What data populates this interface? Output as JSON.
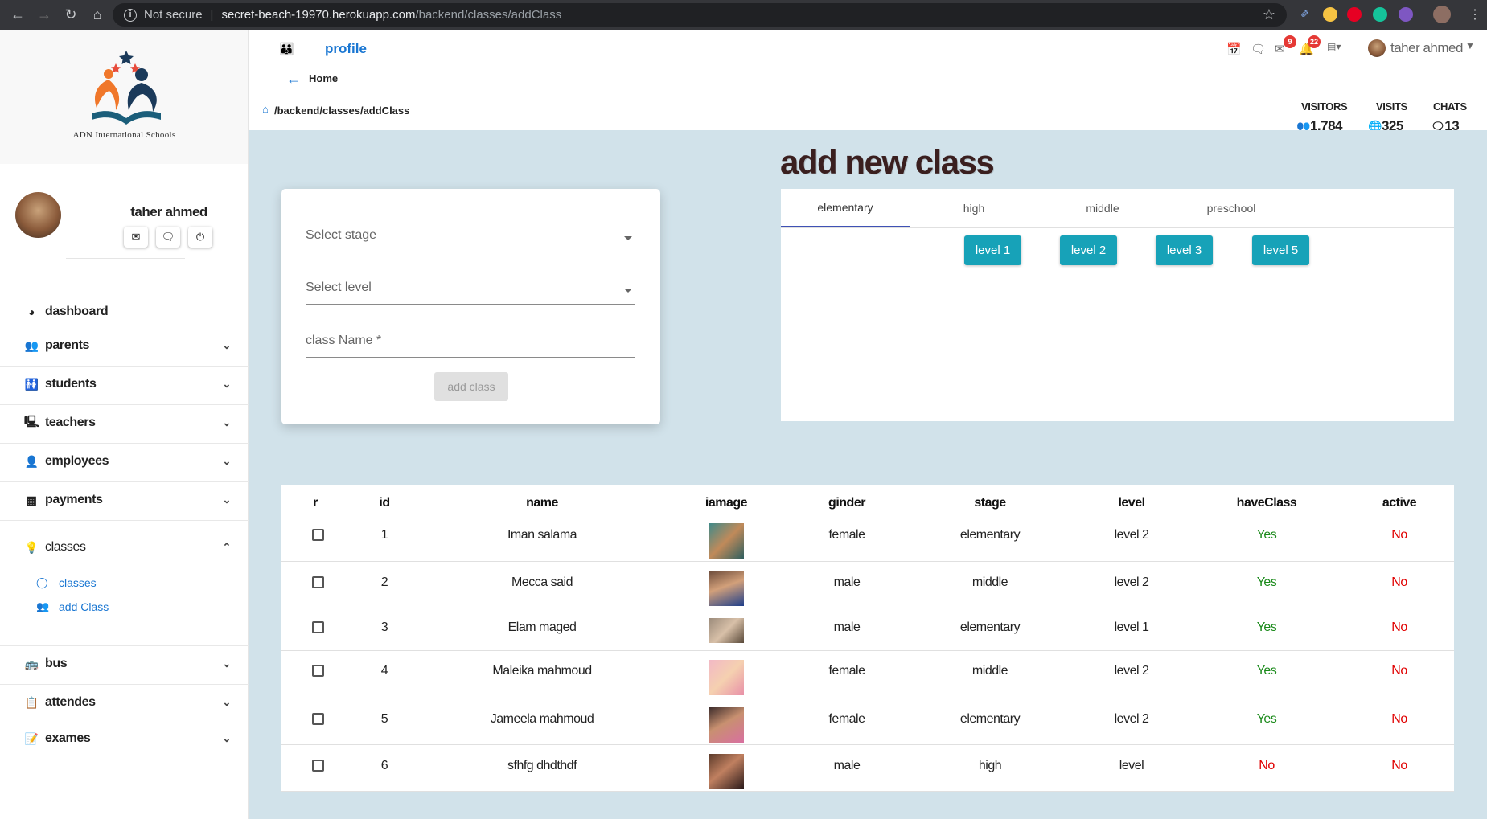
{
  "browser": {
    "security": "Not secure",
    "url_host": "secret-beach-19970.herokuapp.com",
    "url_path": "/backend/classes/addClass",
    "badges": [
      "9",
      "22"
    ]
  },
  "sidebar": {
    "logo_text": "ADN International Schools",
    "user_name": "taher ahmed",
    "items": [
      {
        "label": "dashboard",
        "icon": "dashboard-icon"
      },
      {
        "label": "parents",
        "icon": "parents-icon"
      },
      {
        "label": "students",
        "icon": "students-icon"
      },
      {
        "label": "teachers",
        "icon": "teachers-icon"
      },
      {
        "label": "employees",
        "icon": "employees-icon"
      },
      {
        "label": "payments",
        "icon": "payments-icon"
      },
      {
        "label": "classes",
        "icon": "lightbulb-icon"
      },
      {
        "label": "bus",
        "icon": "bus-icon"
      },
      {
        "label": "attendes",
        "icon": "clipboard-icon"
      },
      {
        "label": "exames",
        "icon": "exam-icon"
      }
    ],
    "sub_items": [
      {
        "label": "classes"
      },
      {
        "label": "add Class"
      }
    ]
  },
  "header": {
    "profile_label": "profile",
    "home_label": "Home",
    "breadcrumb": "/backend/classes/addClass",
    "user_name": "taher ahmed",
    "stats": {
      "visitors_label": "VISITORS",
      "visitors_value": "1,784",
      "visits_label": "VISITS",
      "visits_value": "325",
      "chats_label": "CHATS",
      "chats_value": "13"
    }
  },
  "page": {
    "title": "add new class"
  },
  "form": {
    "stage_placeholder": "Select stage",
    "level_placeholder": "Select level",
    "name_placeholder": "class Name *",
    "submit_label": "add class"
  },
  "tabs": {
    "items": [
      "elementary",
      "high",
      "middle",
      "preschool"
    ],
    "active": "elementary",
    "levels": [
      "level 1",
      "level 2",
      "level 3",
      "level 5"
    ]
  },
  "table": {
    "headers": [
      "r",
      "id",
      "name",
      "iamage",
      "ginder",
      "stage",
      "level",
      "haveClass",
      "active"
    ],
    "rows": [
      {
        "id": "1",
        "name": "Iman salama",
        "gender": "female",
        "stage": "elementary",
        "level": "level 2",
        "haveClass": "Yes",
        "active": "No"
      },
      {
        "id": "2",
        "name": "Mecca said",
        "gender": "male",
        "stage": "middle",
        "level": "level 2",
        "haveClass": "Yes",
        "active": "No"
      },
      {
        "id": "3",
        "name": "Elam maged",
        "gender": "male",
        "stage": "elementary",
        "level": "level 1",
        "haveClass": "Yes",
        "active": "No"
      },
      {
        "id": "4",
        "name": "Maleika mahmoud",
        "gender": "female",
        "stage": "middle",
        "level": "level 2",
        "haveClass": "Yes",
        "active": "No"
      },
      {
        "id": "5",
        "name": "Jameela mahmoud",
        "gender": "female",
        "stage": "elementary",
        "level": "level 2",
        "haveClass": "Yes",
        "active": "No"
      },
      {
        "id": "6",
        "name": "sfhfg dhdthdf",
        "gender": "male",
        "stage": "high",
        "level": "level",
        "haveClass": "No",
        "active": "No"
      }
    ]
  },
  "colors": {
    "accent": "#1976d2",
    "level_button": "#17a2b8",
    "content_bg": "#d1e2ea",
    "yes": "#1a8a1a",
    "no": "#e00000"
  }
}
